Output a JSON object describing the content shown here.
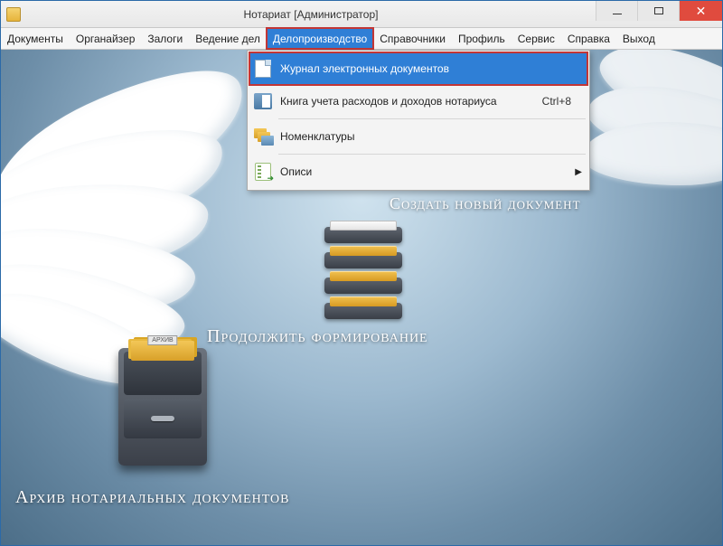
{
  "window": {
    "title": "Нотариат [Администратор]"
  },
  "menubar": {
    "items": [
      "Документы",
      "Органайзер",
      "Залоги",
      "Ведение дел",
      "Делопроизводство",
      "Справочники",
      "Профиль",
      "Сервис",
      "Справка",
      "Выход"
    ],
    "active_index": 4
  },
  "dropdown": {
    "items": [
      {
        "label": "Журнал электронных документов",
        "accel": "",
        "highlight": true,
        "submenu": false,
        "icon": "doc"
      },
      {
        "label": "Книга учета расходов и доходов нотариуса",
        "accel": "Ctrl+8",
        "highlight": false,
        "submenu": false,
        "icon": "book"
      },
      {
        "label": "Номенклатуры",
        "accel": "",
        "highlight": false,
        "submenu": false,
        "icon": "folders"
      },
      {
        "label": "Описи",
        "accel": "",
        "highlight": false,
        "submenu": true,
        "icon": "note"
      }
    ]
  },
  "workspace": {
    "create_label": "Создать новый документ",
    "continue_label": "Продолжить формирование",
    "archive_label": "Архив нотариальных документов",
    "cabinet_tag": "АРХИВ"
  }
}
